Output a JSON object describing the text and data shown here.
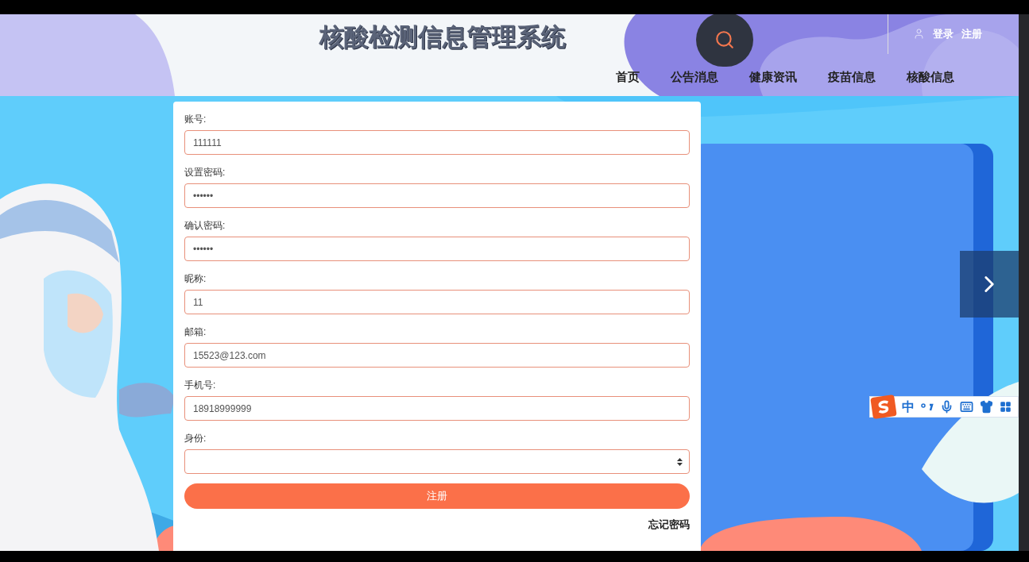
{
  "header": {
    "title": "核酸检测信息管理系统",
    "auth_links": [
      "登录",
      "注册"
    ],
    "nav": [
      {
        "label": "首页"
      },
      {
        "label": "公告消息"
      },
      {
        "label": "健康资讯"
      },
      {
        "label": "疫苗信息"
      },
      {
        "label": "核酸信息"
      }
    ]
  },
  "form": {
    "fields": [
      {
        "kind": "input",
        "label": "账号:",
        "value": "111111"
      },
      {
        "kind": "input",
        "label": "设置密码:",
        "value": "••••••"
      },
      {
        "kind": "input",
        "label": "确认密码:",
        "value": "••••••"
      },
      {
        "kind": "input",
        "label": "昵称:",
        "value": "11"
      },
      {
        "kind": "input",
        "label": "邮箱:",
        "value": "15523@123.com"
      },
      {
        "kind": "input",
        "label": "手机号:",
        "value": "18918999999"
      },
      {
        "kind": "select",
        "label": "身份:"
      }
    ],
    "submit": "注册",
    "forgot_link": "忘记密码"
  },
  "ime_toolbar": {
    "mode": "中"
  }
}
